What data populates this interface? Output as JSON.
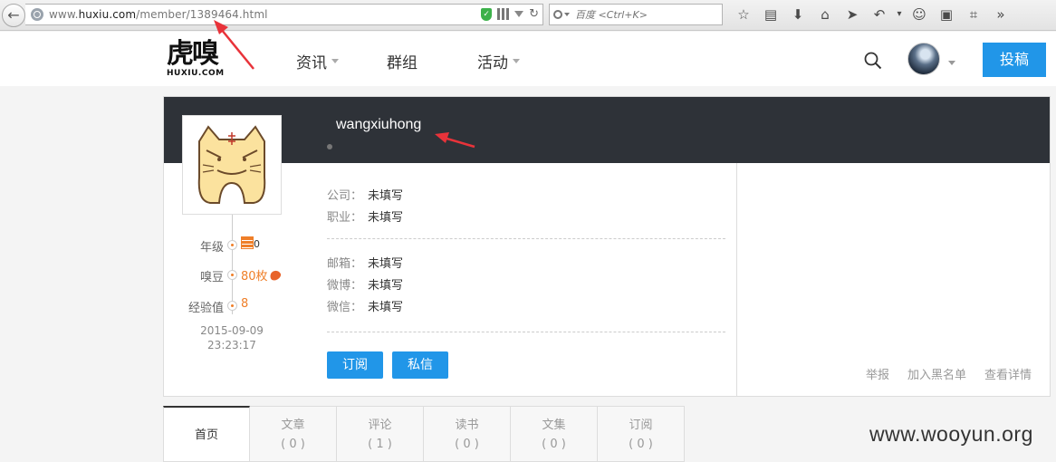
{
  "browser": {
    "url_prefix": "www.",
    "url_domain": "huxiu.com",
    "url_path": "/member/1389464.html",
    "search_placeholder": "百度 <Ctrl+K>"
  },
  "header": {
    "logo_main": "虎嗅",
    "logo_sub": "HUXIU.COM",
    "nav": [
      {
        "label": "资讯",
        "has_dropdown": true
      },
      {
        "label": "群组",
        "has_dropdown": false
      },
      {
        "label": "活动",
        "has_dropdown": true
      }
    ],
    "submit_label": "投稿"
  },
  "profile": {
    "username": "wangxiuhong",
    "stats": {
      "level_label": "年级",
      "level_value": "0",
      "beans_label": "嗅豆",
      "beans_value": "80枚",
      "exp_label": "经验值",
      "exp_value": "8"
    },
    "join_time": "2015-09-09 23:23:17",
    "fields_group1": [
      {
        "key": "公司：",
        "value": "未填写"
      },
      {
        "key": "职业：",
        "value": "未填写"
      }
    ],
    "fields_group2": [
      {
        "key": "邮箱：",
        "value": "未填写"
      },
      {
        "key": "微博：",
        "value": "未填写"
      },
      {
        "key": "微信：",
        "value": "未填写"
      }
    ],
    "buttons": {
      "subscribe": "订阅",
      "message": "私信"
    },
    "side_links": [
      "举报",
      "加入黑名单",
      "查看详情"
    ]
  },
  "tabs": [
    {
      "label": "首页",
      "count": ""
    },
    {
      "label": "文章",
      "count": "( 0 )"
    },
    {
      "label": "评论",
      "count": "( 1 )"
    },
    {
      "label": "读书",
      "count": "( 0 )"
    },
    {
      "label": "文集",
      "count": "( 0 )"
    },
    {
      "label": "订阅",
      "count": "( 0 )"
    }
  ],
  "watermark": "www.wooyun.org",
  "colors": {
    "accent": "#2196e8",
    "banner": "#2e3238",
    "orange": "#ef7f29",
    "annotation": "#e8333a"
  }
}
